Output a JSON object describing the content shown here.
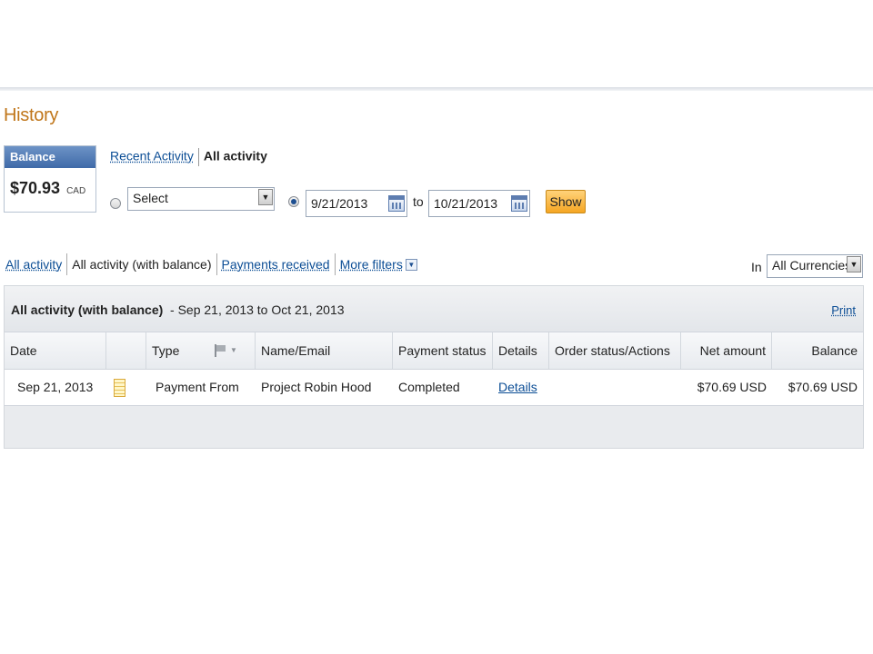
{
  "page": {
    "title": "History"
  },
  "balance": {
    "label": "Balance",
    "amount": "$70.93",
    "currency": "CAD"
  },
  "activity_switch": {
    "recent_label": "Recent Activity",
    "all_label": "All activity"
  },
  "filters": {
    "select_value": "Select",
    "date_from": "9/21/2013",
    "to_label": "to",
    "date_to": "10/21/2013",
    "show_label": "Show",
    "date_range_selected": true
  },
  "tabs": {
    "all_activity": "All activity",
    "all_activity_balance": "All activity (with balance)",
    "payments_received": "Payments received",
    "more_filters": "More filters"
  },
  "currency_filter": {
    "in_label": "In",
    "value": "All Currencies"
  },
  "panel": {
    "title": "All activity (with balance)",
    "range": "- Sep 21, 2013 to Oct 21, 2013",
    "print_label": "Print"
  },
  "table": {
    "columns": [
      "Date",
      "",
      "Type",
      "Name/Email",
      "Payment status",
      "Details",
      "Order status/Actions",
      "Net amount",
      "Balance"
    ],
    "rows": [
      {
        "date": "Sep 21, 2013",
        "type": "Payment From",
        "name": "Project Robin Hood",
        "status": "Completed",
        "details": "Details",
        "order_status": "",
        "net_amount": "$70.69 USD",
        "balance": "$70.69 USD"
      }
    ]
  },
  "colors": {
    "title_orange": "#c0761a",
    "link_blue": "#0b4d95",
    "show_button": "#f5a623",
    "balance_header": "#3f6aa8"
  }
}
